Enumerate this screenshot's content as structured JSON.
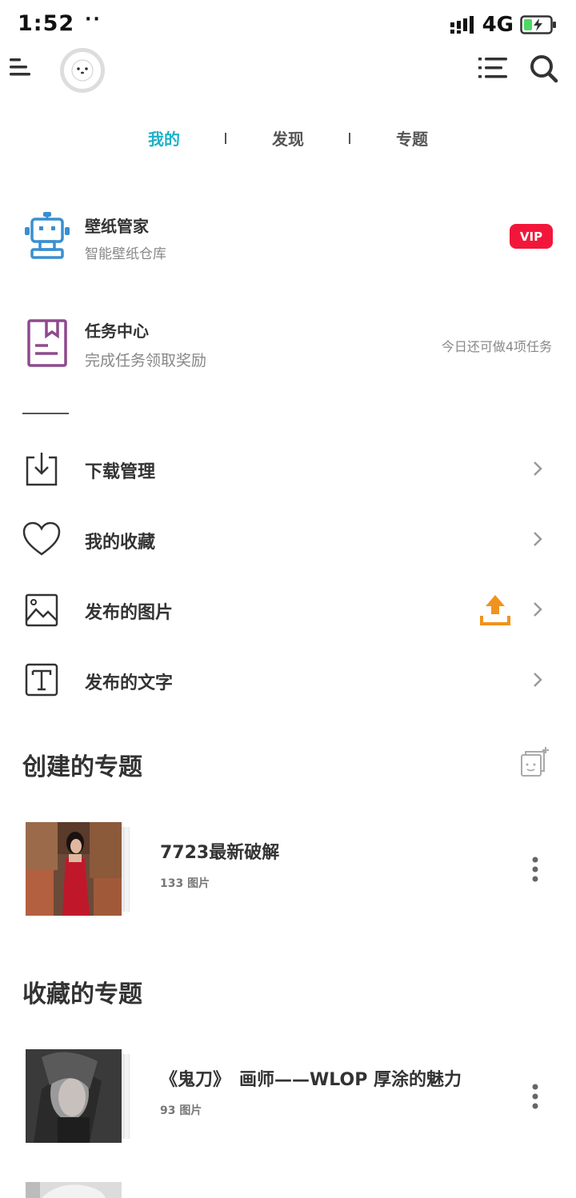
{
  "status_bar": {
    "time": "1:52",
    "dots": "··",
    "network": "4G",
    "icons": [
      "signal-icon",
      "battery-charging-icon"
    ]
  },
  "top_bar": {
    "icons": [
      "menu-icon",
      "avatar-face-icon",
      "list-icon",
      "search-icon"
    ]
  },
  "tabs": [
    {
      "label": "我的",
      "active": true
    },
    {
      "label": "发现",
      "active": false
    },
    {
      "label": "专题",
      "active": false
    }
  ],
  "colors": {
    "accent": "#1cb1c8",
    "vip": "#f2173a",
    "upload": "#f0931e",
    "robot": "#3a8fd0",
    "task": "#8e4a8e"
  },
  "features": {
    "wallpaper": {
      "title": "壁纸管家",
      "subtitle": "智能壁纸仓库",
      "badge": "VIP",
      "icon": "robot-icon"
    },
    "tasks": {
      "title": "任务中心",
      "subtitle": "完成任务领取奖励",
      "note": "今日还可做4项任务",
      "icon": "bookmark-book-icon"
    }
  },
  "menu": [
    {
      "label": "下载管理",
      "icon": "download-tray-icon"
    },
    {
      "label": "我的收藏",
      "icon": "heart-icon"
    },
    {
      "label": "发布的图片",
      "icon": "image-icon",
      "extra_icon": "upload-icon"
    },
    {
      "label": "发布的文字",
      "icon": "text-t-icon"
    }
  ],
  "created_topics": {
    "title": "创建的专题",
    "add_icon": "add-topic-icon",
    "items": [
      {
        "title": "7723最新破解",
        "count": "133 图片"
      }
    ]
  },
  "favorite_topics": {
    "title": "收藏的专题",
    "items": [
      {
        "title": "《鬼刀》　画师——WLOP 厚涂的魅力",
        "count": "93 图片"
      }
    ]
  }
}
